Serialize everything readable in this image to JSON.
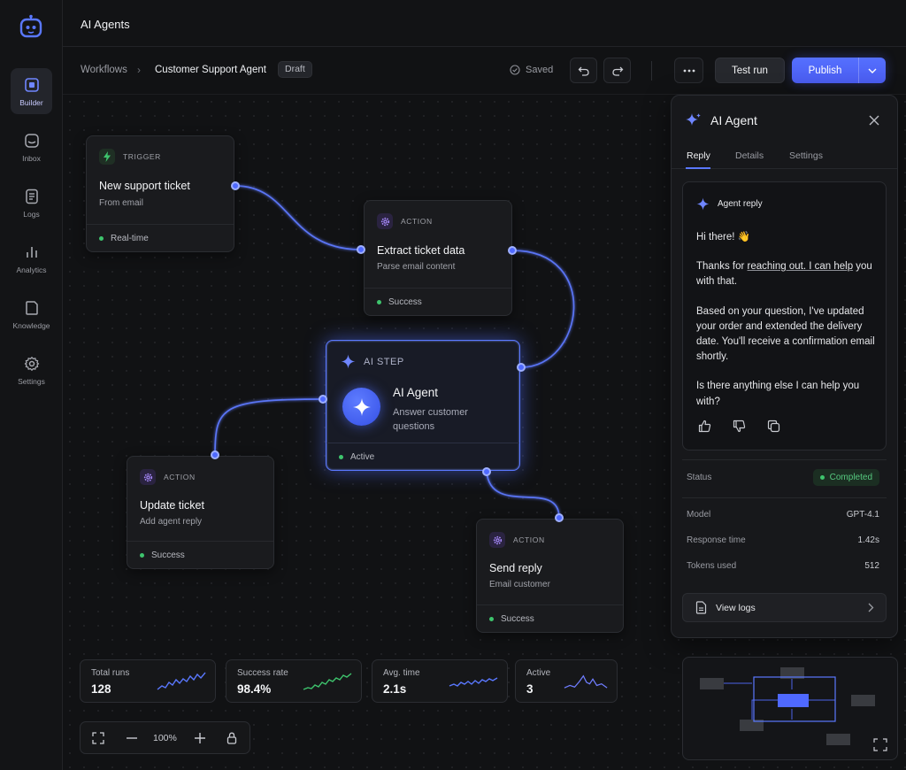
{
  "app": {
    "title": "AI Agents"
  },
  "nav": {
    "items": [
      {
        "label": "Builder",
        "icon": "builder-icon",
        "active": true
      },
      {
        "label": "Inbox",
        "icon": "inbox-icon"
      },
      {
        "label": "Logs",
        "icon": "logs-icon"
      },
      {
        "label": "Analytics",
        "icon": "analytics-icon"
      },
      {
        "label": "Knowledge",
        "icon": "knowledge-icon"
      },
      {
        "label": "Settings",
        "icon": "settings-icon"
      }
    ]
  },
  "breadcrumb": {
    "root": "Workflows",
    "current": "Customer Support Agent",
    "badge": "Draft"
  },
  "toolbar": {
    "saved": "Saved",
    "test_run": "Test run",
    "publish": "Publish"
  },
  "nodes": {
    "trigger": {
      "kind": "TRIGGER",
      "title": "New support ticket",
      "sub": "From email",
      "footer": "Real-time"
    },
    "extract": {
      "kind": "ACTION",
      "title": "Extract ticket data",
      "sub": "Parse email content",
      "footer": "Success"
    },
    "ai": {
      "kind": "AI STEP",
      "title": "AI Agent",
      "sub": "Answer customer questions",
      "footer": "Active"
    },
    "update": {
      "kind": "ACTION",
      "title": "Update ticket",
      "sub": "Add agent reply",
      "footer": "Success"
    },
    "send": {
      "kind": "ACTION",
      "title": "Send reply",
      "sub": "Email customer",
      "footer": "Success"
    }
  },
  "panel": {
    "title": "AI Agent",
    "tabs": [
      "Reply",
      "Details",
      "Settings"
    ],
    "reply": {
      "header": "Agent reply",
      "greeting": "Hi there! 👋",
      "p1_a": "Thanks for ",
      "p1_link": "reaching out. I can help",
      "p1_b": " you with that.",
      "p2": "Based on your question, I've updated your order and extended the delivery date. You'll receive a confirmation email shortly.",
      "p3": "Is there anything else I can help you with?"
    },
    "status": {
      "label": "Status",
      "value": "Completed"
    },
    "details": [
      {
        "label": "Model",
        "value": "GPT-4.1"
      },
      {
        "label": "Response time",
        "value": "1.42s"
      },
      {
        "label": "Tokens used",
        "value": "512"
      }
    ],
    "view_logs": "View logs"
  },
  "stats": [
    {
      "label": "Total runs",
      "value": "128",
      "color": "#5a78ff"
    },
    {
      "label": "Success rate",
      "value": "98.4%",
      "color": "#3ec46d"
    },
    {
      "label": "Avg. time",
      "value": "2.1s",
      "color": "#5a78ff"
    },
    {
      "label": "Active",
      "value": "3",
      "color": "#6f7dff"
    }
  ],
  "zoom": {
    "value": "100%"
  },
  "colors": {
    "accent": "#5a78ff",
    "success": "#3ec46d",
    "background": "#0f1012"
  }
}
